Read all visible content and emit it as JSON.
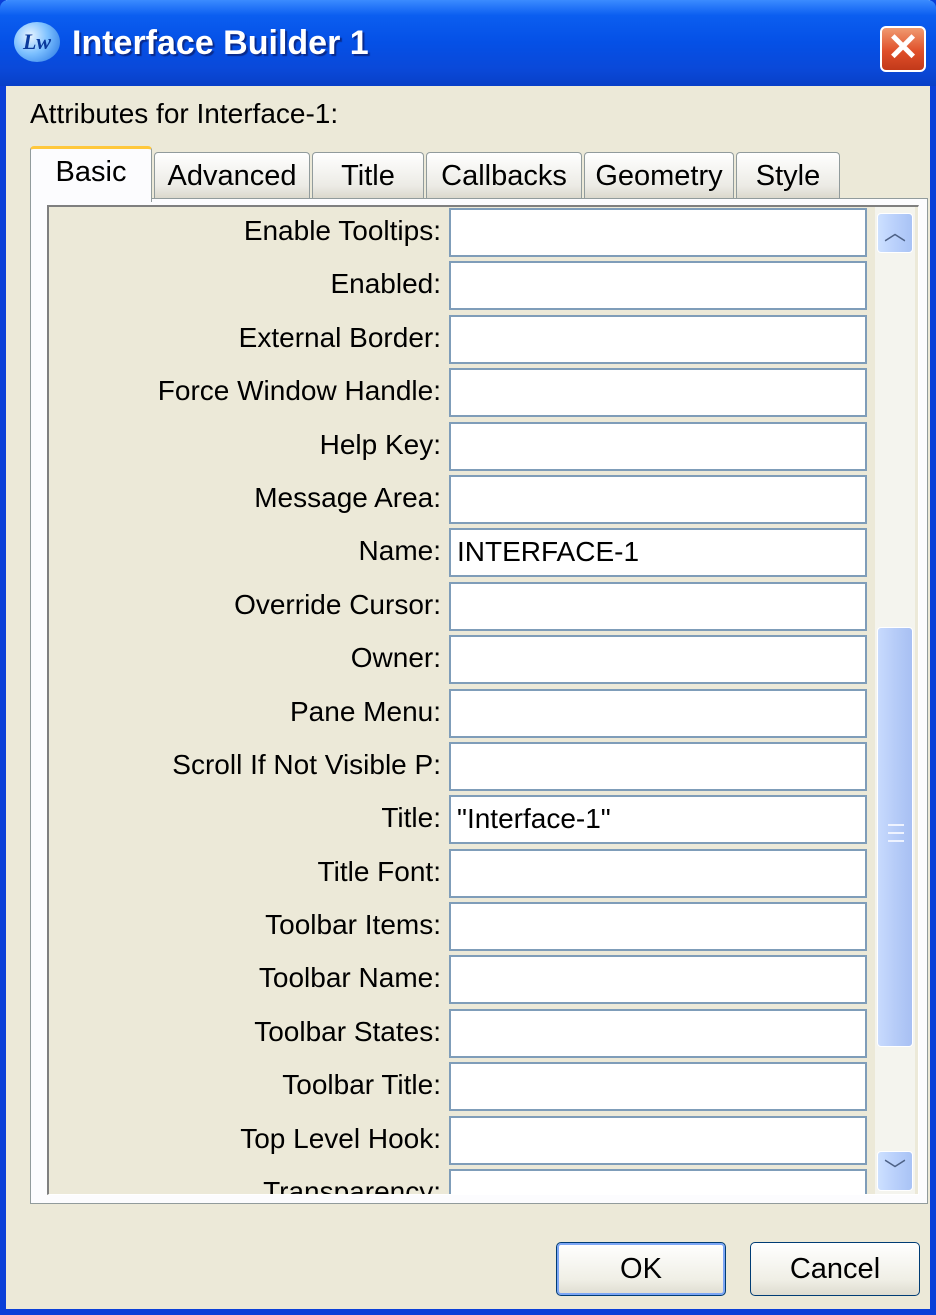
{
  "window": {
    "title": "Interface Builder 1",
    "icon": "lw-app-icon",
    "close_glyph": "✕"
  },
  "attributes_label": "Attributes for Interface-1:",
  "tabs": [
    {
      "label": "Basic",
      "active": true
    },
    {
      "label": "Advanced",
      "active": false
    },
    {
      "label": "Title",
      "active": false
    },
    {
      "label": "Callbacks",
      "active": false
    },
    {
      "label": "Geometry",
      "active": false
    },
    {
      "label": "Style",
      "active": false
    }
  ],
  "attributes": [
    {
      "label": "Enable Tooltips:",
      "value": ""
    },
    {
      "label": "Enabled:",
      "value": ""
    },
    {
      "label": "External Border:",
      "value": ""
    },
    {
      "label": "Force Window Handle:",
      "value": ""
    },
    {
      "label": "Help Key:",
      "value": ""
    },
    {
      "label": "Message Area:",
      "value": ""
    },
    {
      "label": "Name:",
      "value": "INTERFACE-1"
    },
    {
      "label": "Override Cursor:",
      "value": ""
    },
    {
      "label": "Owner:",
      "value": ""
    },
    {
      "label": "Pane Menu:",
      "value": ""
    },
    {
      "label": "Scroll If Not Visible P:",
      "value": ""
    },
    {
      "label": "Title:",
      "value": "\"Interface-1\""
    },
    {
      "label": "Title Font:",
      "value": ""
    },
    {
      "label": "Toolbar Items:",
      "value": ""
    },
    {
      "label": "Toolbar Name:",
      "value": ""
    },
    {
      "label": "Toolbar States:",
      "value": ""
    },
    {
      "label": "Toolbar Title:",
      "value": ""
    },
    {
      "label": "Top Level Hook:",
      "value": ""
    },
    {
      "label": "Transparency:",
      "value": ""
    }
  ],
  "scrollbar": {
    "up_glyph": "︿",
    "down_glyph": "﹀"
  },
  "buttons": {
    "ok": "OK",
    "cancel": "Cancel"
  }
}
